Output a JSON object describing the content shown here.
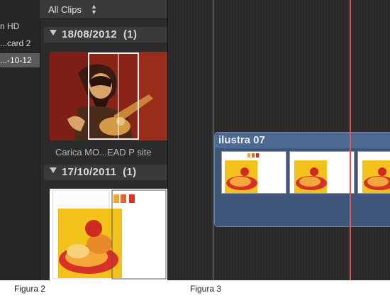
{
  "figure2": {
    "sidebar": {
      "items": [
        {
          "label": "n HD"
        },
        {
          "label": "...card 2"
        },
        {
          "label": "...-10-12",
          "selected": true
        }
      ]
    },
    "toolbar": {
      "filter_label": "All Clips"
    },
    "events": [
      {
        "date": "18/08/2012",
        "count": "(1)",
        "clip_caption": "Carica MO...EAD P site"
      },
      {
        "date": "17/10/2011",
        "count": "(1)"
      }
    ],
    "caption": "Figura 2"
  },
  "figure3": {
    "clip_title": "ilustra 07",
    "caption": "Figura 3"
  },
  "colors": {
    "playhead": "#e0555a",
    "clip_fill": "#3e567a",
    "selection_border": "#f0f0f0"
  }
}
